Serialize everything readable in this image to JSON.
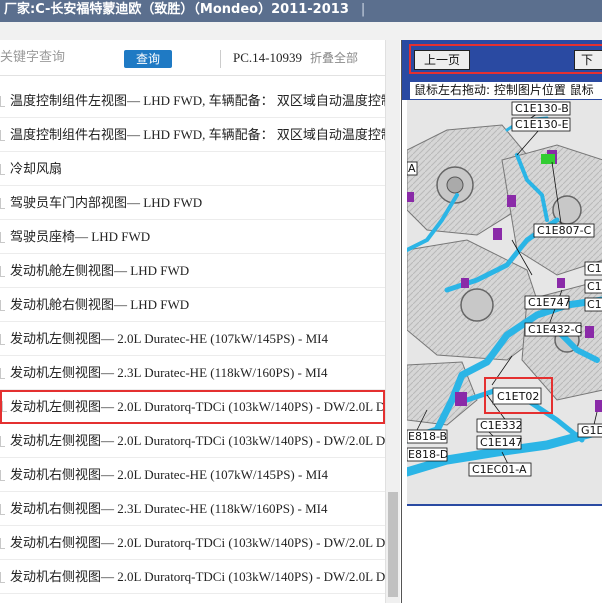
{
  "titlebar": {
    "title": "厂家:C-长安福特蒙迪欧（致胜）（Mondeo）2011-2013",
    "separator": "|"
  },
  "search": {
    "placeholder": "关键字查询",
    "query_label": "查询",
    "pc_code": "PC.14-10939",
    "collapse_all": "折叠全部"
  },
  "tree": {
    "items": [
      {
        "label": "温度控制组件左视图— LHD FWD, 车辆配备： 双区域自动温度控制"
      },
      {
        "label": "温度控制组件右视图— LHD FWD, 车辆配备： 双区域自动温度控制"
      },
      {
        "label": "冷却风扇"
      },
      {
        "label": "驾驶员车门内部视图— LHD FWD"
      },
      {
        "label": "驾驶员座椅— LHD FWD"
      },
      {
        "label": "发动机舱左侧视图— LHD FWD"
      },
      {
        "label": "发动机舱右侧视图— LHD FWD"
      },
      {
        "label": "发动机左侧视图— 2.0L Duratec-HE (107kW/145PS) - MI4"
      },
      {
        "label": "发动机左侧视图— 2.3L Duratec-HE (118kW/160PS) - MI4"
      },
      {
        "label": "发动机左侧视图— 2.0L Duratorq-TDCi (103kW/140PS) - DW/2.0L D",
        "selected": true
      },
      {
        "label": "发动机左侧视图— 2.0L Duratorq-TDCi (103kW/140PS) - DW/2.0L D"
      },
      {
        "label": "发动机右侧视图— 2.0L Duratec-HE (107kW/145PS) - MI4"
      },
      {
        "label": "发动机右侧视图— 2.3L Duratec-HE (118kW/160PS) - MI4"
      },
      {
        "label": "发动机右侧视图— 2.0L Duratorq-TDCi (103kW/140PS) - DW/2.0L D"
      },
      {
        "label": "发动机右侧视图— 2.0L Duratorq-TDCi (103kW/140PS) - DW/2.0L D"
      }
    ]
  },
  "viewer": {
    "prev_label": "上一页",
    "next_label": "下",
    "hint": "鼠标左右拖动: 控制图片位置   鼠标"
  },
  "diagram": {
    "callouts": {
      "c1e130b": "C1E130-B",
      "c1e130e": "C1E130-E",
      "a": "A",
      "c1e807c": "C1E807-C",
      "c1": "C1",
      "c1e747": "C1E747",
      "c1e432c": "C1E432-C",
      "c1et02": "C1ET02",
      "c1e332": "C1E332",
      "c1e147": "C1E147",
      "e818b": "E818-B",
      "e818d": "E818-D",
      "g1d": "G1D",
      "c1ec01a": "C1EC01-A"
    }
  },
  "colors": {
    "titlebar": "#5b6f8e",
    "accent_blue": "#2a4aa2",
    "button_blue": "#1f7ac4",
    "highlight_red": "#e43030",
    "harness_cyan": "#2bb5e6",
    "connector_purple": "#8a2aa8",
    "connector_green": "#33cc33"
  }
}
